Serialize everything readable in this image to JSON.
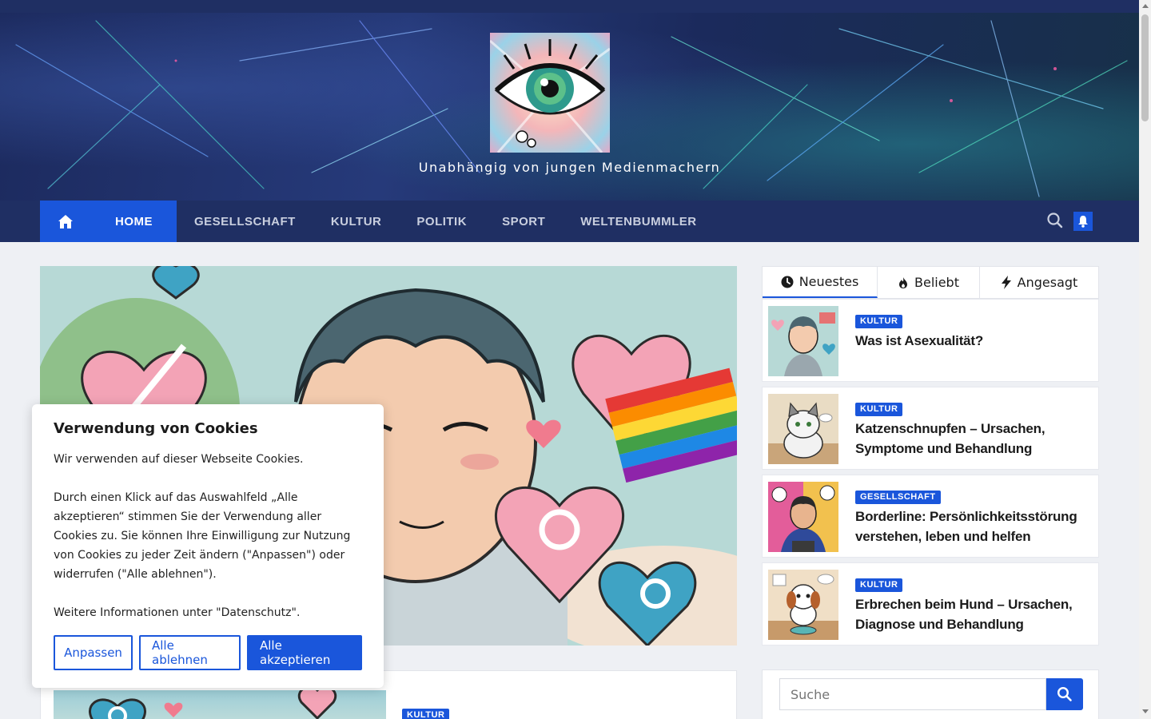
{
  "site": {
    "tagline": "Unabhängig von jungen Medienmachern"
  },
  "nav": {
    "home_icon": "home-icon",
    "items": [
      {
        "label": "HOME",
        "active": true
      },
      {
        "label": "GESELLSCHAFT"
      },
      {
        "label": "KULTUR"
      },
      {
        "label": "POLITIK"
      },
      {
        "label": "SPORT"
      },
      {
        "label": "WELTENBUMMLER"
      }
    ],
    "search_icon": "search-icon",
    "bell_icon": "bell-icon"
  },
  "main": {
    "post_card": {
      "category": "KULTUR"
    }
  },
  "sidebar": {
    "tabs": [
      {
        "label": "Neuestes",
        "icon": "clock-icon",
        "active": true
      },
      {
        "label": "Beliebt",
        "icon": "fire-icon"
      },
      {
        "label": "Angesagt",
        "icon": "bolt-icon"
      }
    ],
    "posts": [
      {
        "category": "KULTUR",
        "title": "Was ist Asexualität?"
      },
      {
        "category": "KULTUR",
        "title": "Katzenschnupfen – Ursachen, Symptome und Behandlung"
      },
      {
        "category": "GESELLSCHAFT",
        "title": "Borderline: Persönlichkeitsstörung verstehen, leben und helfen"
      },
      {
        "category": "KULTUR",
        "title": "Erbrechen beim Hund – Ursachen, Diagnose und Behandlung"
      }
    ],
    "search": {
      "placeholder": "Suche"
    }
  },
  "cookie": {
    "title": "Verwendung von Cookies",
    "text": "Wir verwenden auf dieser Webseite Cookies.\n\nDurch einen Klick auf das Auswahlfeld „Alle akzeptieren“ stimmen Sie der Verwendung aller Cookies zu. Sie können Ihre Einwilligung zur Nutzung von Cookies zu jeder Zeit ändern (\"Anpassen\") oder widerrufen (\"Alle ablehnen\").\n\nWeitere Informationen unter \"Datenschutz\".",
    "btn_customize": "Anpassen",
    "btn_reject": "Alle ablehnen",
    "btn_accept": "Alle akzeptieren"
  },
  "colors": {
    "accent": "#1a56db",
    "nav_bg": "#1f2f63"
  }
}
